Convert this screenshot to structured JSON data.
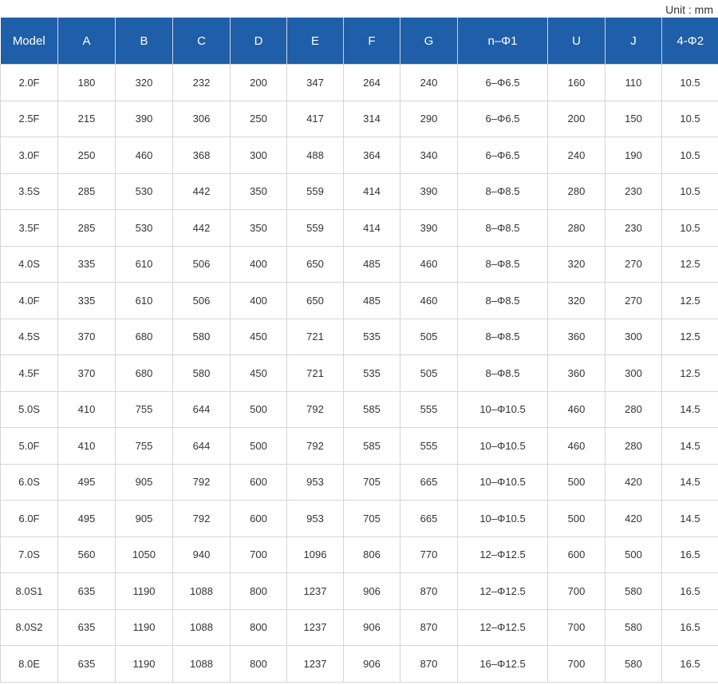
{
  "unit_label": "Unit : mm",
  "table": {
    "headers": [
      "Model",
      "A",
      "B",
      "C",
      "D",
      "E",
      "F",
      "G",
      "n–Φ1",
      "U",
      "J",
      "4-Φ2"
    ],
    "rows": [
      [
        "2.0F",
        "180",
        "320",
        "232",
        "200",
        "347",
        "264",
        "240",
        "6–Φ6.5",
        "160",
        "110",
        "10.5"
      ],
      [
        "2.5F",
        "215",
        "390",
        "306",
        "250",
        "417",
        "314",
        "290",
        "6–Φ6.5",
        "200",
        "150",
        "10.5"
      ],
      [
        "3.0F",
        "250",
        "460",
        "368",
        "300",
        "488",
        "364",
        "340",
        "6–Φ6.5",
        "240",
        "190",
        "10.5"
      ],
      [
        "3.5S",
        "285",
        "530",
        "442",
        "350",
        "559",
        "414",
        "390",
        "8–Φ8.5",
        "280",
        "230",
        "10.5"
      ],
      [
        "3.5F",
        "285",
        "530",
        "442",
        "350",
        "559",
        "414",
        "390",
        "8–Φ8.5",
        "280",
        "230",
        "10.5"
      ],
      [
        "4.0S",
        "335",
        "610",
        "506",
        "400",
        "650",
        "485",
        "460",
        "8–Φ8.5",
        "320",
        "270",
        "12.5"
      ],
      [
        "4.0F",
        "335",
        "610",
        "506",
        "400",
        "650",
        "485",
        "460",
        "8–Φ8.5",
        "320",
        "270",
        "12.5"
      ],
      [
        "4.5S",
        "370",
        "680",
        "580",
        "450",
        "721",
        "535",
        "505",
        "8–Φ8.5",
        "360",
        "300",
        "12.5"
      ],
      [
        "4.5F",
        "370",
        "680",
        "580",
        "450",
        "721",
        "535",
        "505",
        "8–Φ8.5",
        "360",
        "300",
        "12.5"
      ],
      [
        "5.0S",
        "410",
        "755",
        "644",
        "500",
        "792",
        "585",
        "555",
        "10–Φ10.5",
        "460",
        "280",
        "14.5"
      ],
      [
        "5.0F",
        "410",
        "755",
        "644",
        "500",
        "792",
        "585",
        "555",
        "10–Φ10.5",
        "460",
        "280",
        "14.5"
      ],
      [
        "6.0S",
        "495",
        "905",
        "792",
        "600",
        "953",
        "705",
        "665",
        "10–Φ10.5",
        "500",
        "420",
        "14.5"
      ],
      [
        "6.0F",
        "495",
        "905",
        "792",
        "600",
        "953",
        "705",
        "665",
        "10–Φ10.5",
        "500",
        "420",
        "14.5"
      ],
      [
        "7.0S",
        "560",
        "1050",
        "940",
        "700",
        "1096",
        "806",
        "770",
        "12–Φ12.5",
        "600",
        "500",
        "16.5"
      ],
      [
        "8.0S1",
        "635",
        "1190",
        "1088",
        "800",
        "1237",
        "906",
        "870",
        "12–Φ12.5",
        "700",
        "580",
        "16.5"
      ],
      [
        "8.0S2",
        "635",
        "1190",
        "1088",
        "800",
        "1237",
        "906",
        "870",
        "12–Φ12.5",
        "700",
        "580",
        "16.5"
      ],
      [
        "8.0E",
        "635",
        "1190",
        "1088",
        "800",
        "1237",
        "906",
        "870",
        "16–Φ12.5",
        "700",
        "580",
        "16.5"
      ]
    ]
  }
}
